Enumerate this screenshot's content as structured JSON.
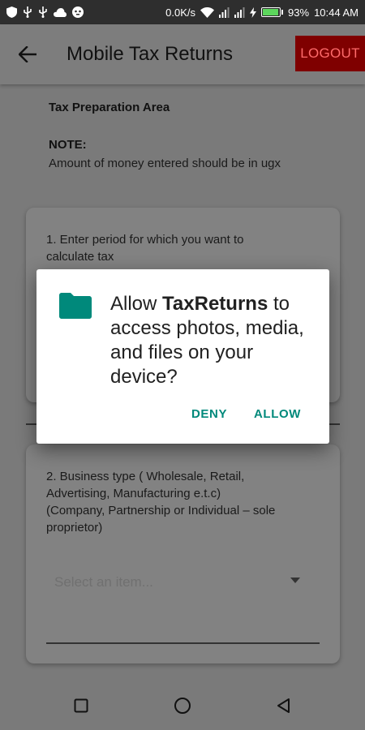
{
  "status_bar": {
    "speed": "0.0K/s",
    "battery_percent": "93%",
    "battery_level": 0.93,
    "time": "10:44 AM",
    "icons": [
      "shield-icon",
      "usb-icon",
      "usb-icon",
      "cloud-icon",
      "game-icon",
      "wifi-icon",
      "signal-icon",
      "signal-icon",
      "charging-icon",
      "battery-icon"
    ]
  },
  "appbar": {
    "title": "Mobile Tax Returns",
    "back_icon": "arrow-left-icon",
    "logout_label": "LOGOUT"
  },
  "main": {
    "area_title": "Tax Preparation Area",
    "note_label": "NOTE:",
    "note_text": "Amount of money entered should be in ugx",
    "card1": {
      "prompt_line1": "1. Enter period for which you want to",
      "prompt_line2": "calculate tax"
    },
    "card2": {
      "prompt_line1": "2. Business type ( Wholesale, Retail,",
      "prompt_line2": "Advertising, Manufacturing e.t.c)",
      "prompt_line3": "(Company, Partnership or Individual – sole",
      "prompt_line4": "proprietor)",
      "select_placeholder": "Select an item..."
    }
  },
  "dialog": {
    "icon": "folder-icon",
    "message_prefix": "Allow ",
    "app_name": "TaxReturns",
    "message_suffix": " to access photos, media, and files on your device?",
    "deny_label": "DENY",
    "allow_label": "ALLOW",
    "accent_color": "#00897b"
  },
  "navbar": {
    "icons": [
      "recents-square-icon",
      "home-circle-icon",
      "back-triangle-icon"
    ]
  }
}
